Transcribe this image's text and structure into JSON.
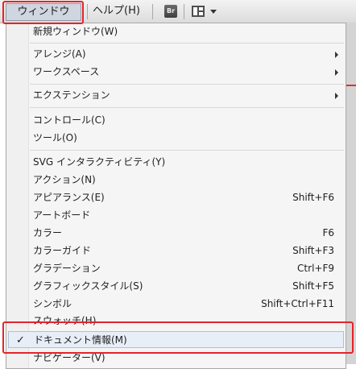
{
  "menubar": {
    "window_label": "ウィンドウ(W)",
    "help_label": "ヘルプ(H)",
    "bridge_label": "Br"
  },
  "menu": {
    "new_window": "新規ウィンドウ(W)",
    "arrange": "アレンジ(A)",
    "workspace": "ワークスペース",
    "extensions": "エクステンション",
    "control": "コントロール(C)",
    "tools": "ツール(O)",
    "svg_interactivity": "SVG インタラクティビティ(Y)",
    "actions": "アクション(N)",
    "appearance": "アピアランス(E)",
    "appearance_sc": "Shift+F6",
    "artboards": "アートボード",
    "color": "カラー",
    "color_sc": "F6",
    "color_guide": "カラーガイド",
    "color_guide_sc": "Shift+F3",
    "gradient": "グラデーション",
    "gradient_sc": "Ctrl+F9",
    "graphic_styles": "グラフィックスタイル(S)",
    "graphic_styles_sc": "Shift+F5",
    "symbols": "シンボル",
    "symbols_sc": "Shift+Ctrl+F11",
    "swatches": "スウォッチ(H)",
    "document_info": "ドキュメント情報(M)",
    "document_info_check": "✓",
    "navigator": "ナビゲーター(V)"
  }
}
